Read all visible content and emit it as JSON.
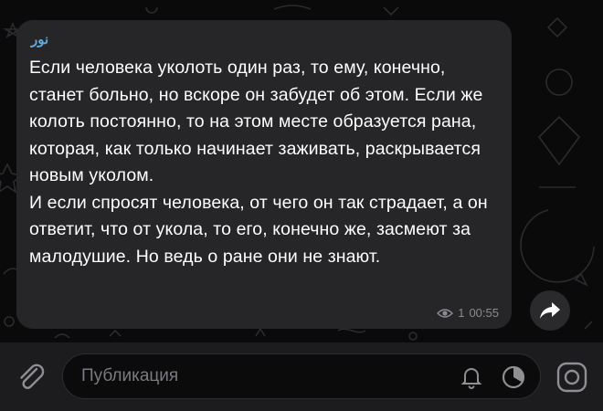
{
  "message": {
    "sender": "نور",
    "paragraphs": [
      "Если человека уколоть один раз, то ему, конечно, станет больно, но вскоре он забудет об этом. Если же колоть постоянно, то на этом месте образуется рана, которая, как только начинает заживать, раскрывается новым уколом.",
      "И если спросят человека, от чего он так страдает, а он ответит, что от укола, то его, конечно же, засмеют за малодушие. Но ведь о ране они не знают."
    ],
    "views": "1",
    "time": "00:55"
  },
  "composer": {
    "placeholder": "Публикация"
  },
  "icons": {
    "views": "eye-icon",
    "share": "share-arrow-icon",
    "attach": "paperclip-icon",
    "notifications": "bell-icon",
    "timer": "timer-icon",
    "camera": "camera-icon"
  },
  "colors": {
    "background": "#0a0a0a",
    "bubble": "#262528",
    "sender": "#5ea9dd",
    "meta": "#8b8a8f",
    "bar": "#1c1c1e"
  }
}
